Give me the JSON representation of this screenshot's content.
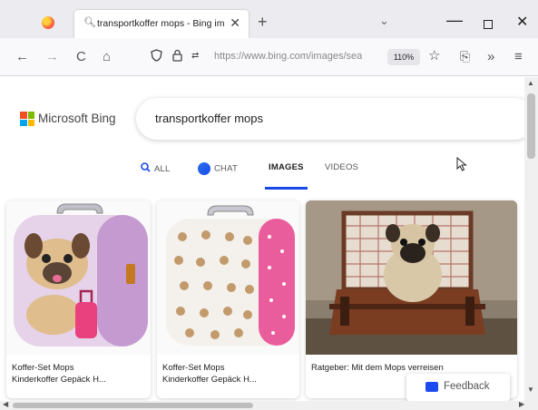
{
  "browser": {
    "tab_title": "transportkoffer mops - Bing im",
    "tab_close": "✕",
    "new_tab": "+",
    "tab_list": "⌄",
    "min": "—",
    "close": "✕",
    "url": "https://www.bing.com/images/sea",
    "zoom": "110%"
  },
  "nav_icons": {
    "back": "←",
    "forward": "→",
    "reload": "C",
    "home": "⌂",
    "shield": "♡",
    "lock": "🔒",
    "permissions": "⇄",
    "star": "☆",
    "extensions": "⎘",
    "overflow": "»",
    "menu": "≡"
  },
  "bing": {
    "brand": "Microsoft Bing",
    "query": "transportkoffer mops",
    "tabs": [
      {
        "label": "ALL",
        "icon": "search-icon"
      },
      {
        "label": "CHAT",
        "icon": "chat-icon"
      },
      {
        "label": "IMAGES"
      },
      {
        "label": "VIDEOS"
      }
    ],
    "results": [
      {
        "line1": "Koffer-Set Mops",
        "line2": "Kinderkoffer Gepäck H..."
      },
      {
        "line1": "Koffer-Set Mops",
        "line2": "Kinderkoffer Gepäck H..."
      },
      {
        "line1": "Ratgeber: Mit dem Mops verreisen",
        "line2": ""
      }
    ],
    "feedback": "Feedback"
  },
  "colors": {
    "accent": "#174ae4",
    "chrome": "#ececf0",
    "toolbar": "#f9f9fb"
  }
}
